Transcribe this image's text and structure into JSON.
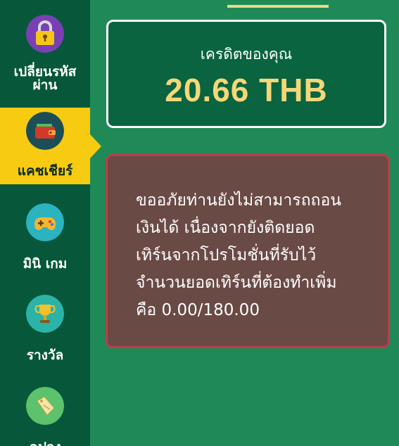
{
  "sidebar": {
    "items": [
      {
        "label": "เปลี่ยนรหัส\nผ่าน",
        "icon": "padlock-icon"
      },
      {
        "label": "แคชเชียร์",
        "icon": "wallet-icon",
        "active": true
      },
      {
        "label": "มินิ เกม",
        "icon": "gamepad-icon"
      },
      {
        "label": "รางวัล",
        "icon": "trophy-icon"
      },
      {
        "label": "คูปอง",
        "icon": "coupon-tag-icon"
      }
    ]
  },
  "credit": {
    "label": "เครดิตของคุณ",
    "value": "20.66 THB"
  },
  "warning": {
    "message": "ขออภัยท่านยังไม่สามารถถอน\nเงินได้ เนื่องจากยังติดยอด\nเทิร์นจากโปรโมชั่นที่รับไว้\nจำนวนยอดเทิร์นที่ต้องทำเพิ่ม\nคือ 0.00/180.00"
  },
  "colors": {
    "background": "#1f8a57",
    "sidebar": "#07583a",
    "active": "#f6cb12",
    "credit_value": "#f5d77a",
    "warning_border": "#c13b48"
  }
}
